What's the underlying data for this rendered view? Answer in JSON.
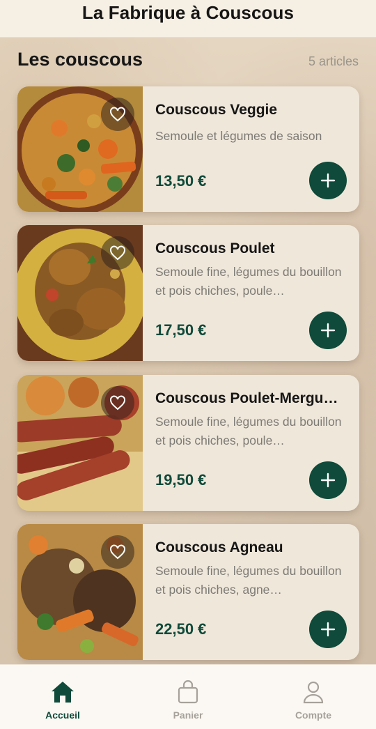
{
  "app": {
    "title": "La Fabrique à Couscous"
  },
  "section": {
    "title": "Les couscous",
    "count": "5 articles"
  },
  "products": [
    {
      "name": "Couscous Veggie",
      "description": "Semoule et légumes de saison",
      "price": "13,50 €"
    },
    {
      "name": "Couscous Poulet",
      "description": "Semoule fine, légumes du bouillon et pois chiches, poule…",
      "price": "17,50 €"
    },
    {
      "name": "Couscous Poulet-Mergu…",
      "description": "Semoule fine, légumes du bouillon et pois chiches, poule…",
      "price": "19,50 €"
    },
    {
      "name": "Couscous Agneau",
      "description": "Semoule fine, légumes du bouillon et pois chiches, agne…",
      "price": "22,50 €"
    }
  ],
  "tabs": [
    {
      "label": "Accueil",
      "icon": "home-icon",
      "active": true
    },
    {
      "label": "Panier",
      "icon": "bag-icon",
      "active": false
    },
    {
      "label": "Compte",
      "icon": "user-icon",
      "active": false
    }
  ],
  "colors": {
    "accent": "#0f4a3a",
    "card": "#efe7da",
    "header": "#f6efe4"
  }
}
